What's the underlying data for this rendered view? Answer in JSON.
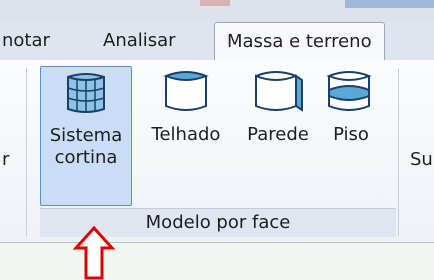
{
  "tabs": [
    {
      "label": "notar",
      "active": false
    },
    {
      "label": "Analisar",
      "active": false
    },
    {
      "label": "Massa e terreno",
      "active": true
    }
  ],
  "ribbon": {
    "left_clipped_text": "r",
    "buttons": [
      {
        "line1": "Sistema",
        "line2": "cortina",
        "icon": "curtain-system-icon",
        "selected": true
      },
      {
        "line1": "Telhado",
        "line2": "",
        "icon": "roof-icon",
        "selected": false
      },
      {
        "line1": "Parede",
        "line2": "",
        "icon": "wall-icon",
        "selected": false
      },
      {
        "line1": "Piso",
        "line2": "",
        "icon": "floor-icon",
        "selected": false
      }
    ],
    "right_clipped_text": "Su",
    "panel_label": "Modelo por face"
  },
  "colors": {
    "selected_bg": "#c9ddf6",
    "selected_border": "#5a8fd0",
    "arrow": "#e00000"
  }
}
